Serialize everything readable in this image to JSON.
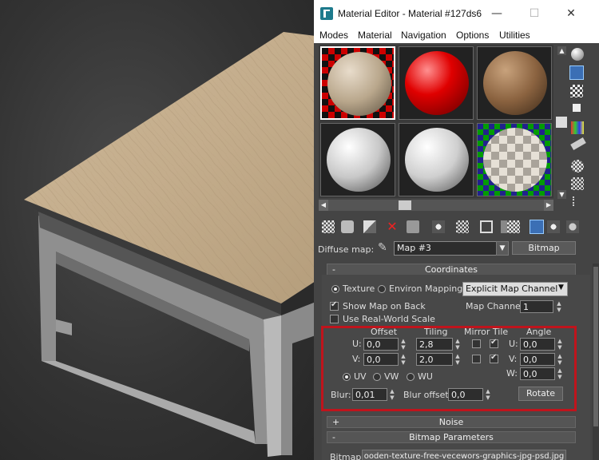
{
  "window": {
    "title": "Material Editor - Material #127ds6",
    "minimize": "—",
    "maximize": "☐",
    "close": "✕"
  },
  "menu": [
    "Modes",
    "Material",
    "Navigation",
    "Options",
    "Utilities"
  ],
  "diffuse": {
    "label": "Diffuse map:",
    "map_name": "Map #3",
    "map_type": "Bitmap"
  },
  "rollouts": {
    "coordinates": "Coordinates",
    "noise": "Noise",
    "bitmap_params": "Bitmap Parameters",
    "collapse_sign": "-",
    "expand_sign": "+"
  },
  "coordinates": {
    "texture_label": "Texture",
    "environ_label": "Environ",
    "mapping_label": "Mapping:",
    "mapping_value": "Explicit Map Channel",
    "show_map_label": "Show Map on Back",
    "map_channel_label": "Map Channel:",
    "map_channel_value": "1",
    "real_world_label": "Use Real-World Scale",
    "offset_header": "Offset",
    "tiling_header": "Tiling",
    "mirror_tile_header": "Mirror Tile",
    "angle_header": "Angle",
    "u_label": "U:",
    "v_label": "V:",
    "w_label": "W:",
    "u_offset": "0,0",
    "v_offset": "0,0",
    "u_tiling": "2,8",
    "v_tiling": "2,0",
    "u_angle": "0,0",
    "v_angle": "0,0",
    "w_angle": "0,0",
    "uv_label": "UV",
    "vw_label": "VW",
    "wu_label": "WU",
    "blur_label": "Blur:",
    "blur_value": "0,01",
    "blur_offset_label": "Blur offset:",
    "blur_offset_value": "0,0",
    "rotate_label": "Rotate"
  },
  "bitmap": {
    "label": "Bitmap:",
    "path": "ooden-texture-free-vecewors-graphics-jpg-psd.jpg"
  },
  "colors": {
    "highlight": "#c0141c",
    "active_tool": "#3b6fb5"
  }
}
